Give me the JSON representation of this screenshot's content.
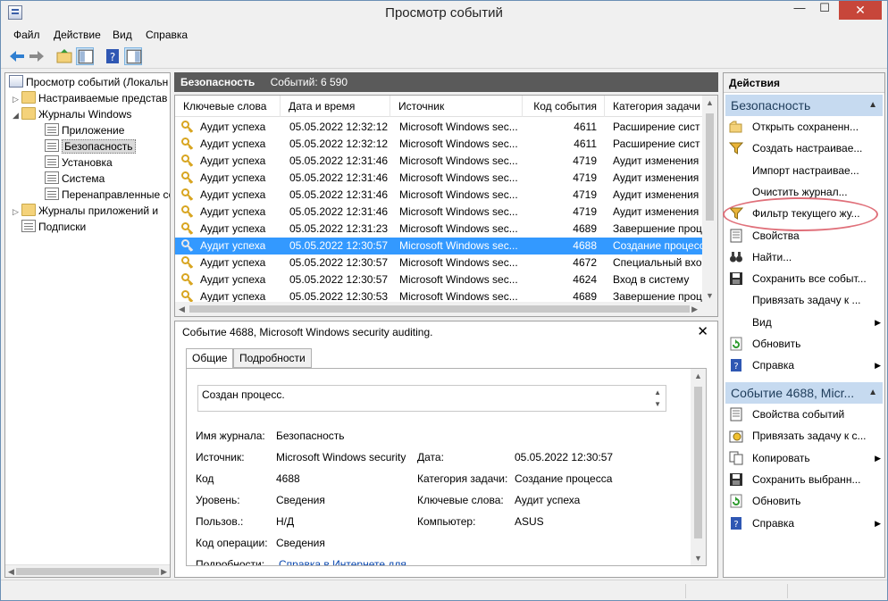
{
  "window": {
    "title": "Просмотр событий",
    "controls": {
      "minimize": "—",
      "maximize": "☐",
      "close": "✕"
    }
  },
  "menu": [
    "Файл",
    "Действие",
    "Вид",
    "Справка"
  ],
  "tree": {
    "items": [
      {
        "label": "Просмотр событий (Локальн",
        "icon": "event-viewer-icon",
        "indent": 0,
        "twisty": ""
      },
      {
        "label": "Настраиваемые представ",
        "icon": "folder-icon",
        "indent": 1,
        "twisty": "▷"
      },
      {
        "label": "Журналы Windows",
        "icon": "folder-icon",
        "indent": 1,
        "twisty": "◢"
      },
      {
        "label": "Приложение",
        "icon": "log-icon",
        "indent": 2,
        "twisty": ""
      },
      {
        "label": "Безопасность",
        "icon": "log-icon",
        "indent": 2,
        "twisty": "",
        "selected": true
      },
      {
        "label": "Установка",
        "icon": "log-icon",
        "indent": 2,
        "twisty": ""
      },
      {
        "label": "Система",
        "icon": "log-icon",
        "indent": 2,
        "twisty": ""
      },
      {
        "label": "Перенаправленные со",
        "icon": "log-icon",
        "indent": 2,
        "twisty": ""
      },
      {
        "label": "Журналы приложений и",
        "icon": "folder-icon",
        "indent": 1,
        "twisty": "▷"
      },
      {
        "label": "Подписки",
        "icon": "log-icon",
        "indent": 1,
        "twisty": ""
      }
    ]
  },
  "center": {
    "log_name": "Безопасность",
    "event_count": "Событий: 6 590",
    "columns": [
      "Ключевые слова",
      "Дата и время",
      "Источник",
      "Код события",
      "Категория задачи"
    ],
    "rows": [
      [
        "Аудит успеха",
        "05.05.2022 12:32:12",
        "Microsoft Windows sec...",
        "4611",
        "Расширение сист"
      ],
      [
        "Аудит успеха",
        "05.05.2022 12:32:12",
        "Microsoft Windows sec...",
        "4611",
        "Расширение сист"
      ],
      [
        "Аудит успеха",
        "05.05.2022 12:31:46",
        "Microsoft Windows sec...",
        "4719",
        "Аудит изменения"
      ],
      [
        "Аудит успеха",
        "05.05.2022 12:31:46",
        "Microsoft Windows sec...",
        "4719",
        "Аудит изменения"
      ],
      [
        "Аудит успеха",
        "05.05.2022 12:31:46",
        "Microsoft Windows sec...",
        "4719",
        "Аудит изменения"
      ],
      [
        "Аудит успеха",
        "05.05.2022 12:31:46",
        "Microsoft Windows sec...",
        "4719",
        "Аудит изменения"
      ],
      [
        "Аудит успеха",
        "05.05.2022 12:31:23",
        "Microsoft Windows sec...",
        "4689",
        "Завершение проц"
      ],
      [
        "Аудит успеха",
        "05.05.2022 12:30:57",
        "Microsoft Windows sec...",
        "4688",
        "Создание процесс"
      ],
      [
        "Аудит успеха",
        "05.05.2022 12:30:57",
        "Microsoft Windows sec...",
        "4672",
        "Специальный вхо"
      ],
      [
        "Аудит успеха",
        "05.05.2022 12:30:57",
        "Microsoft Windows sec...",
        "4624",
        "Вход в систему"
      ],
      [
        "Аудит успеха",
        "05.05.2022 12:30:53",
        "Microsoft Windows sec...",
        "4689",
        "Завершение проц"
      ]
    ],
    "selected_row": 7
  },
  "details": {
    "title": "Событие 4688, Microsoft Windows security auditing.",
    "close": "✕",
    "tabs": [
      "Общие",
      "Подробности"
    ],
    "message": "Создан процесс.",
    "fields": {
      "log_name_label": "Имя журнала:",
      "log_name": "Безопасность",
      "source_label": "Источник:",
      "source": "Microsoft Windows security",
      "date_label": "Дата:",
      "date": "05.05.2022 12:30:57",
      "code_label": "Код",
      "code": "4688",
      "category_label": "Категория задачи:",
      "category": "Создание процесса",
      "level_label": "Уровень:",
      "level": "Сведения",
      "keywords_label": "Ключевые слова:",
      "keywords": "Аудит успеха",
      "user_label": "Пользов.:",
      "user": "Н/Д",
      "computer_label": "Компьютер:",
      "computer": "ASUS",
      "opcode_label": "Код операции:",
      "opcode": "Сведения",
      "more_label": "Подробности:",
      "more_link": "Справка в Интернете для"
    }
  },
  "actions": {
    "title": "Действия",
    "section1": "Безопасность",
    "section1_items": [
      {
        "label": "Открыть сохраненн...",
        "icon": "open-folder-icon",
        "submenu": false
      },
      {
        "label": "Создать настраивае...",
        "icon": "filter-icon",
        "submenu": false
      },
      {
        "label": "Импорт настраивае...",
        "icon": "",
        "submenu": false
      },
      {
        "label": "Очистить журнал...",
        "icon": "",
        "submenu": false
      },
      {
        "label": "Фильтр текущего жу...",
        "icon": "filter-icon",
        "submenu": false
      },
      {
        "label": "Свойства",
        "icon": "properties-icon",
        "submenu": false
      },
      {
        "label": "Найти...",
        "icon": "binoculars-icon",
        "submenu": false
      },
      {
        "label": "Сохранить все событ...",
        "icon": "save-icon",
        "submenu": false
      },
      {
        "label": "Привязать задачу к ...",
        "icon": "",
        "submenu": false
      },
      {
        "label": "Вид",
        "icon": "",
        "submenu": true
      },
      {
        "label": "Обновить",
        "icon": "refresh-icon",
        "submenu": false
      },
      {
        "label": "Справка",
        "icon": "help-icon",
        "submenu": true
      }
    ],
    "section2": "Событие 4688, Micr...",
    "section2_items": [
      {
        "label": "Свойства событий",
        "icon": "properties-icon",
        "submenu": false
      },
      {
        "label": "Привязать задачу к с...",
        "icon": "task-icon",
        "submenu": false
      },
      {
        "label": "Копировать",
        "icon": "copy-icon",
        "submenu": true
      },
      {
        "label": "Сохранить выбранн...",
        "icon": "save-icon",
        "submenu": false
      },
      {
        "label": "Обновить",
        "icon": "refresh-icon",
        "submenu": false
      },
      {
        "label": "Справка",
        "icon": "help-icon",
        "submenu": true
      }
    ],
    "submenu_arrow": "▶"
  },
  "colors": {
    "selection": "#3399ff",
    "header_dark": "#5a5a5a",
    "section_bg": "#c6daf0",
    "highlight": "#e0707a",
    "close_btn": "#c7463a"
  }
}
